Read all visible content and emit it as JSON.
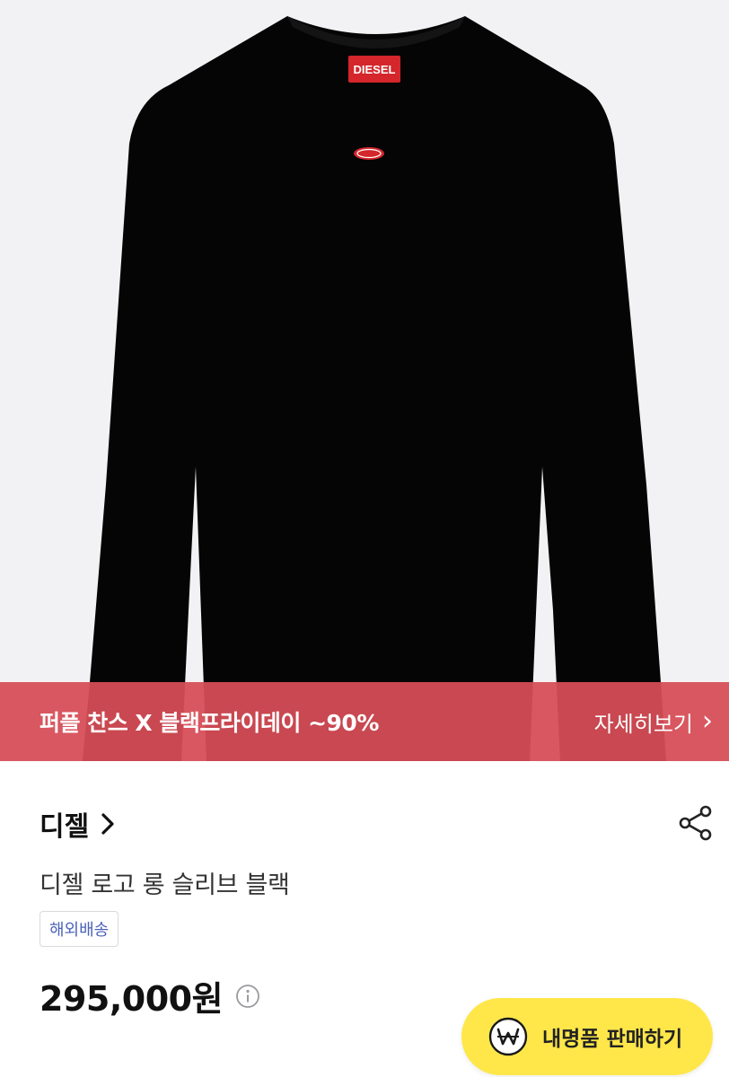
{
  "product_image": {
    "logo_text": "DIESEL",
    "colors": {
      "garment": "#050505",
      "logo_patch": "#d4262b",
      "background": "#f2f2f4"
    }
  },
  "promo": {
    "text": "퍼플 찬스 X 블랙프라이데이 ~90%",
    "more_label": "자세히보기",
    "color": "#d64c56"
  },
  "brand": {
    "name": "디젤"
  },
  "product": {
    "name": "디젤 로고 롱 슬리브 블랙",
    "tag": "해외배송",
    "price": "295,000원"
  },
  "sell_button": {
    "label": "내명품 판매하기",
    "color": "#ffe74a"
  },
  "icons": [
    "chevron-right-icon",
    "share-icon",
    "info-icon",
    "won-icon"
  ]
}
